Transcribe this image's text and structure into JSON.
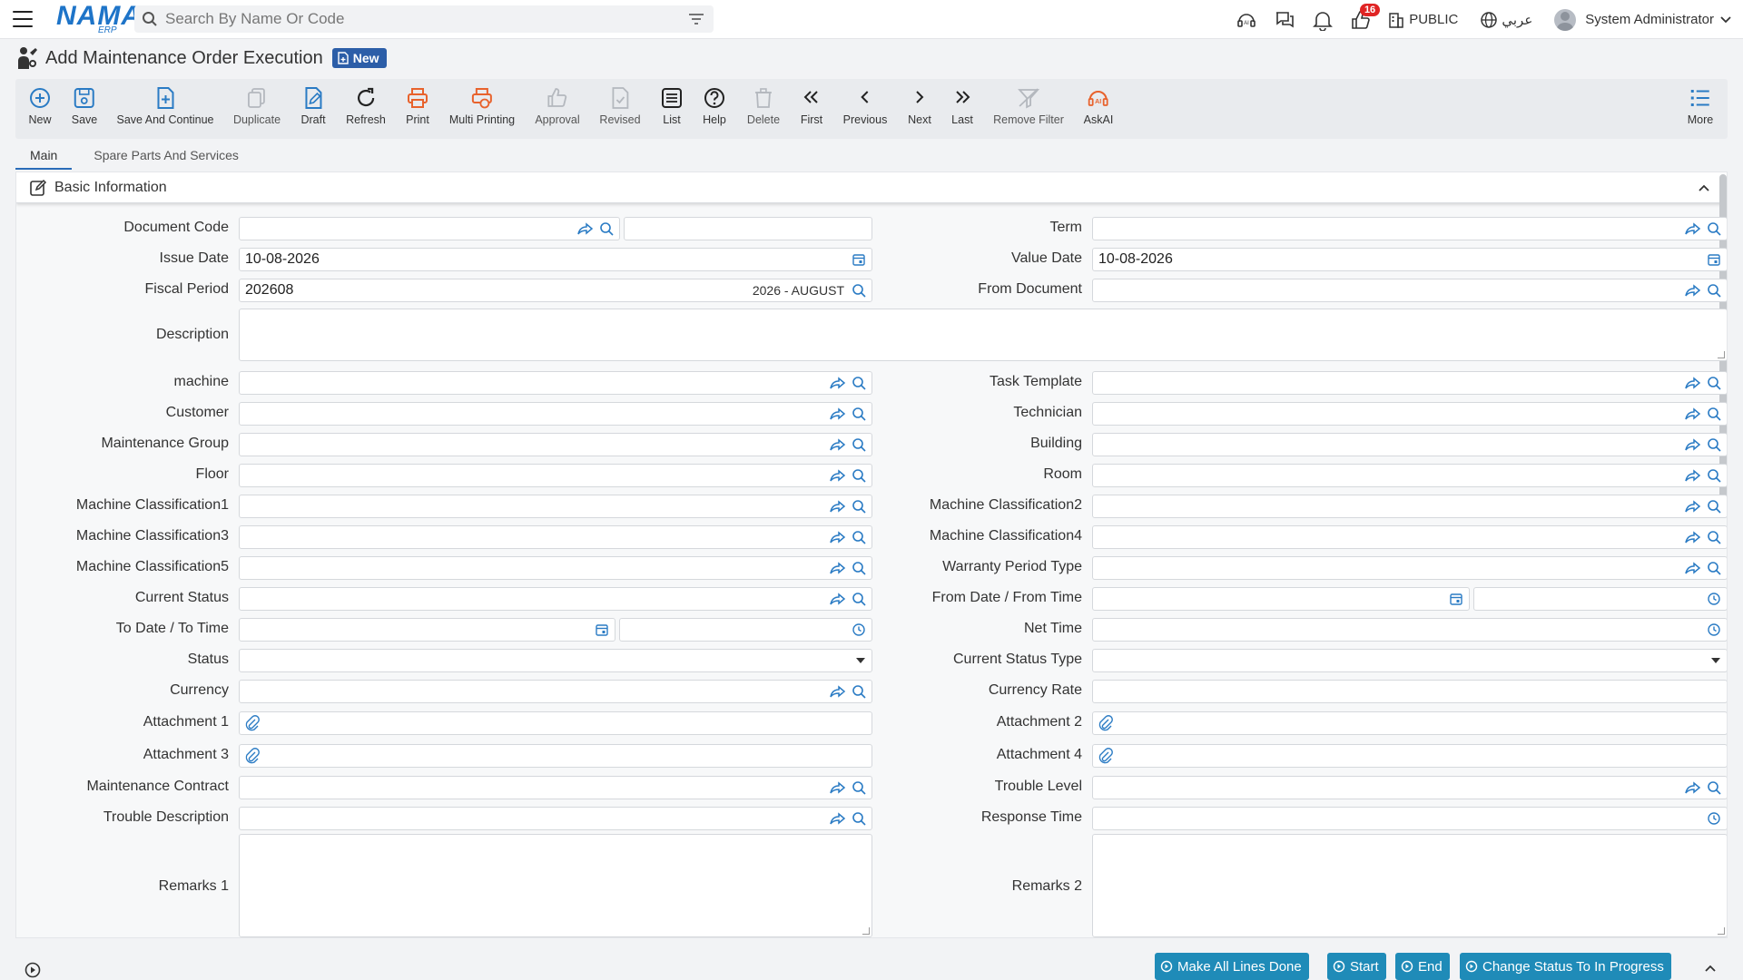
{
  "app": {
    "logo": "NAMA",
    "logo_sub": "ERP"
  },
  "topbar": {
    "search_placeholder": "Search By Name Or Code",
    "notification_count": "16",
    "branch": "PUBLIC",
    "language": "عربي",
    "user": "System Administrator"
  },
  "page": {
    "title": "Add Maintenance Order Execution",
    "mode_badge": "New"
  },
  "toolbar": {
    "new": "New",
    "save": "Save",
    "save_continue": "Save And Continue",
    "duplicate": "Duplicate",
    "draft": "Draft",
    "refresh": "Refresh",
    "print": "Print",
    "multi_printing": "Multi Printing",
    "approval": "Approval",
    "revised": "Revised",
    "list": "List",
    "help": "Help",
    "delete": "Delete",
    "first": "First",
    "previous": "Previous",
    "next": "Next",
    "last": "Last",
    "remove_filter": "Remove Filter",
    "askai": "AskAI",
    "more": "More"
  },
  "tabs": {
    "main": "Main",
    "spare_parts": "Spare Parts And Services"
  },
  "section": {
    "basic_information": "Basic Information"
  },
  "labels": {
    "document_code": "Document Code",
    "term": "Term",
    "issue_date": "Issue Date",
    "value_date": "Value Date",
    "fiscal_period": "Fiscal Period",
    "from_document": "From Document",
    "description": "Description",
    "machine": "machine",
    "task_template": "Task Template",
    "customer": "Customer",
    "technician": "Technician",
    "maintenance_group": "Maintenance Group",
    "building": "Building",
    "floor": "Floor",
    "room": "Room",
    "machine_class1": "Machine Classification1",
    "machine_class2": "Machine Classification2",
    "machine_class3": "Machine Classification3",
    "machine_class4": "Machine Classification4",
    "machine_class5": "Machine Classification5",
    "warranty_period_type": "Warranty Period Type",
    "current_status": "Current Status",
    "from_date_time": "From Date / From Time",
    "to_date_time": "To Date / To Time",
    "net_time": "Net Time",
    "status": "Status",
    "current_status_type": "Current Status Type",
    "currency": "Currency",
    "currency_rate": "Currency Rate",
    "attachment1": "Attachment 1",
    "attachment2": "Attachment 2",
    "attachment3": "Attachment 3",
    "attachment4": "Attachment 4",
    "maintenance_contract": "Maintenance Contract",
    "trouble_level": "Trouble Level",
    "trouble_description": "Trouble Description",
    "response_time": "Response Time",
    "remarks1": "Remarks 1",
    "remarks2": "Remarks 2"
  },
  "values": {
    "issue_date": "10-08-2026",
    "value_date": "10-08-2026",
    "fiscal_period": "202608",
    "fiscal_period_name": "2026 - AUGUST"
  },
  "actions": {
    "make_all_lines_done": "Make All Lines Done",
    "start": "Start",
    "end": "End",
    "change_status": "Change Status To In Progress"
  },
  "colors": {
    "brand": "#1e74c8",
    "accent_button": "#1f8bb8",
    "badge": "#2c5ea8",
    "alert": "#e02424",
    "print_icon": "#e8622c"
  }
}
